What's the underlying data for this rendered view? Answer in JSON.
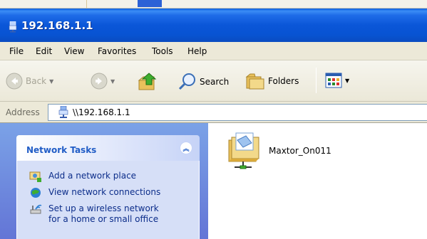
{
  "window": {
    "title": "192.168.1.1"
  },
  "menu": {
    "items": [
      "File",
      "Edit",
      "View",
      "Favorites",
      "Tools",
      "Help"
    ]
  },
  "toolbar": {
    "back_label": "Back",
    "search_label": "Search",
    "folders_label": "Folders"
  },
  "address": {
    "label": "Address",
    "value": "\\\\192.168.1.1"
  },
  "tasks": {
    "title": "Network Tasks",
    "items": [
      {
        "label_lines": [
          "Add a network place"
        ],
        "icon": "network-place-icon"
      },
      {
        "label_lines": [
          "View network connections"
        ],
        "icon": "network-connections-icon"
      },
      {
        "label_lines": [
          "Set up a wireless network",
          "for a home or small office"
        ],
        "icon": "wireless-setup-icon"
      }
    ]
  },
  "content": {
    "items": [
      {
        "name": "Maxtor_On011",
        "icon": "shared-folder-icon"
      }
    ]
  },
  "colors": {
    "title_bar": "#0a56d8",
    "task_pane": "#6e8fe0",
    "task_text": "#0c2d8a",
    "task_header_text": "#215dc6"
  }
}
